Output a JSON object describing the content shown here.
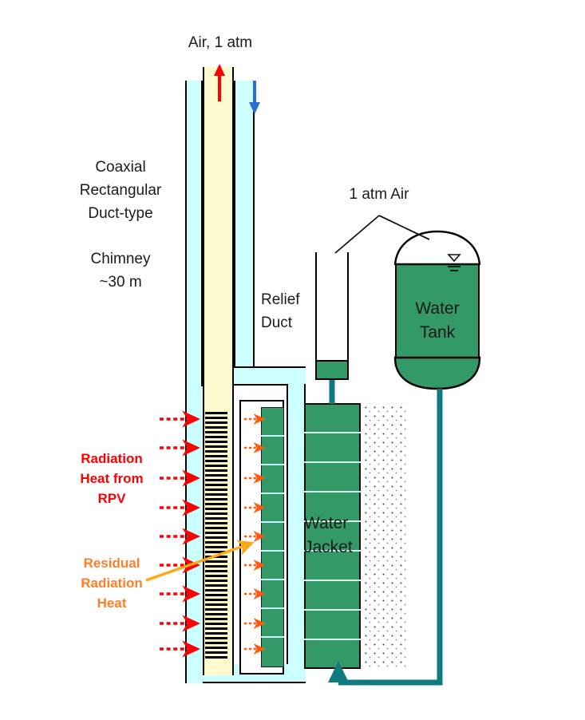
{
  "diagram": {
    "title_labels": {
      "chimney_air": "Air, 1 atm",
      "chimney_type": "Coaxial\nRectangular\nDuct-type",
      "chimney_height": "Chimney\n~30 m",
      "relief_duct": "Relief\nDuct",
      "tank_air": "1 atm Air",
      "water_tank": "Water\nTank",
      "water_jacket": "Water\nJacket",
      "radiation_heat": "Radiation\nHeat from\nRPV",
      "residual_heat": "Residual\nRadiation\nHeat"
    },
    "colors": {
      "inner_duct_air": "#FFFACD",
      "outer_duct_air": "#CCFFFF",
      "water_green": "#339966",
      "pipe_teal": "#0F7B80",
      "radiation_red": "#FF0000",
      "residual_orange": "#FF7F28",
      "pointer_amber": "#FFAA14",
      "updraft_arrow": "#FF0000",
      "downdraft_arrow": "#2B6FD4",
      "outline": "#000000"
    },
    "flow_arrows": {
      "updraft_icon": "up-arrow-icon",
      "downdraft_icon": "down-arrow-icon",
      "radiation_arrow_icon": "dashed-right-arrow-icon",
      "residual_arrow_icon": "small-dashed-right-arrow-icon",
      "pointer_arrow_icon": "diagonal-pointer-arrow-icon",
      "return_flow_icon": "up-arrow-icon",
      "radiation_arrow_count": 9,
      "residual_arrow_count": 9
    },
    "water_jacket": {
      "segment_count": 9,
      "inner_column_segment_count": 9
    },
    "water_tank": {
      "level_marker_icon": "water-level-icon"
    }
  }
}
